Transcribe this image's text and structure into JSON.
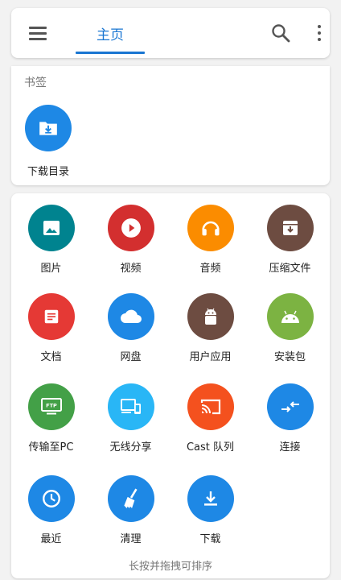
{
  "header": {
    "home_tab": "主页"
  },
  "bookmarks": {
    "title": "书签",
    "items": [
      {
        "label": "下载目录",
        "icon": "download-folder-icon",
        "color": "#1e88e5"
      }
    ]
  },
  "tiles": [
    {
      "label": "图片",
      "icon": "image-icon",
      "color": "#00838f"
    },
    {
      "label": "视频",
      "icon": "play-icon",
      "color": "#d32f2f"
    },
    {
      "label": "音频",
      "icon": "headphones-icon",
      "color": "#fb8c00"
    },
    {
      "label": "压缩文件",
      "icon": "archive-icon",
      "color": "#6d4c41"
    },
    {
      "label": "文档",
      "icon": "document-icon",
      "color": "#e53935"
    },
    {
      "label": "网盘",
      "icon": "cloud-icon",
      "color": "#1e88e5"
    },
    {
      "label": "用户应用",
      "icon": "android-icon",
      "color": "#6d4c41"
    },
    {
      "label": "安装包",
      "icon": "android-icon",
      "color": "#7cb342"
    },
    {
      "label": "传输至PC",
      "icon": "ftp-monitor-icon",
      "color": "#43a047"
    },
    {
      "label": "无线分享",
      "icon": "devices-icon",
      "color": "#29b6f6"
    },
    {
      "label": "Cast 队列",
      "icon": "cast-icon",
      "color": "#f4511e"
    },
    {
      "label": "连接",
      "icon": "connect-arrows-icon",
      "color": "#1e88e5"
    },
    {
      "label": "最近",
      "icon": "clock-icon",
      "color": "#1e88e5"
    },
    {
      "label": "清理",
      "icon": "broom-icon",
      "color": "#1e88e5"
    },
    {
      "label": "下载",
      "icon": "download-icon",
      "color": "#1e88e5"
    }
  ],
  "hint": "长按并拖拽可排序"
}
